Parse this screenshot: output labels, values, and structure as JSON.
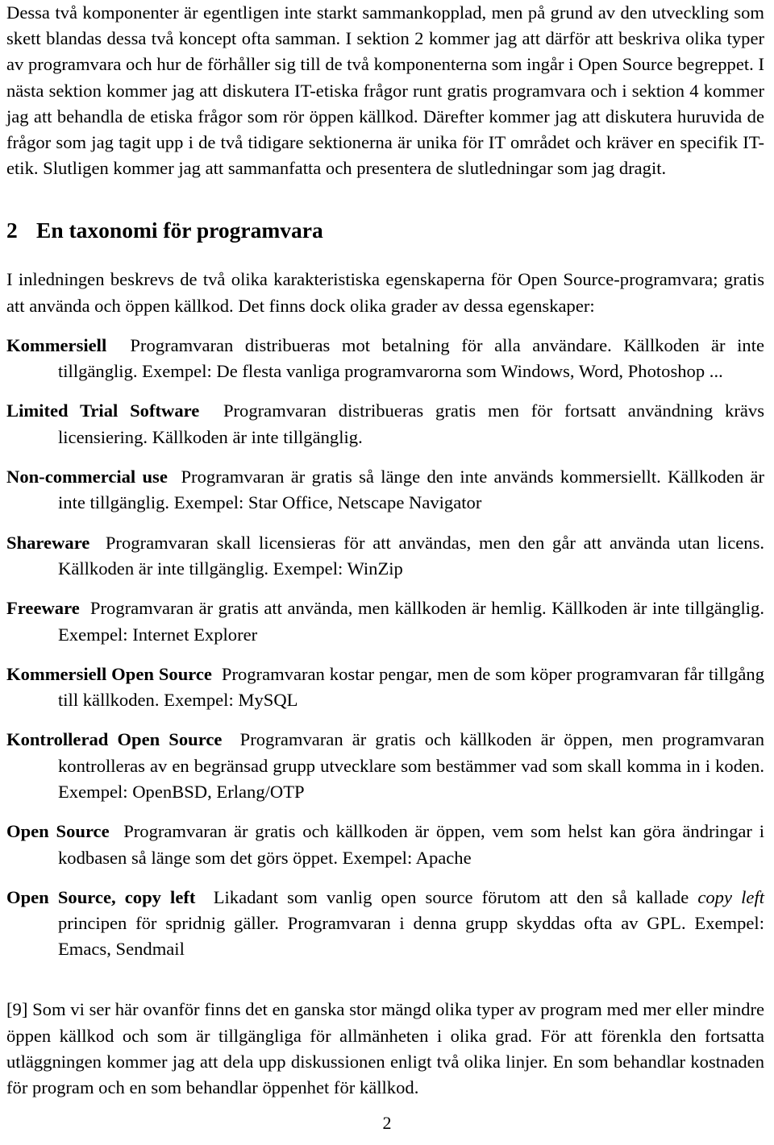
{
  "document": {
    "language": "sv",
    "page_number": "2",
    "paragraphs": {
      "intro": "Dessa två komponenter är egentligen inte starkt sammankopplad, men på grund av den utveckling som skett blandas dessa två koncept ofta samman. I sektion 2 kommer jag att därför att beskriva olika typer av programvara och hur de förhåller sig till de två komponenterna som ingår i Open Source begreppet. I nästa sektion kommer jag att diskutera IT-etiska frågor runt gratis programvara och i sektion 4 kommer jag att behandla de etiska frågor som rör öppen källkod. Därefter kommer jag att diskutera huruvida de frågor som jag tagit upp i de två tidigare sektionerna är unika för IT området och kräver en specifik IT-etik. Slutligen kommer jag att sammanfatta och presentera de slutledningar som jag dragit.",
      "section_intro": "I inledningen beskrevs de två olika karakteristiska egenskaperna för Open Source-programvara; gratis att använda och öppen källkod. Det finns dock olika grader av dessa egenskaper:",
      "final": "[9] Som vi ser här ovanför finns det en ganska stor mängd olika typer av program med mer eller mindre öppen källkod och som är tillgängliga för allmänheten i olika grad. För att förenkla den fortsatta utläggningen kommer jag att dela upp diskussionen enligt två olika linjer. En som behandlar kostnaden för program och en som behandlar öppenhet för källkod."
    },
    "section": {
      "number": "2",
      "title": "En taxonomi för programvara"
    },
    "taxonomy": [
      {
        "term": "Kommersiell",
        "description": "Programvaran distribueras mot betalning för alla användare. Källkoden är inte tillgänglig. Exempel: De flesta vanliga programvarorna som Windows, Word, Photoshop ..."
      },
      {
        "term": "Limited Trial Software",
        "description": "Programvaran distribueras gratis men för fortsatt användning krävs licensiering. Källkoden är inte tillgänglig."
      },
      {
        "term": "Non-commercial use",
        "description": "Programvaran är gratis så länge den inte används kommersiellt. Källkoden är inte tillgänglig. Exempel: Star Office, Netscape Navigator"
      },
      {
        "term": "Shareware",
        "description": "Programvaran skall licensieras för att användas, men den går att använda utan licens. Källkoden är inte tillgänglig. Exempel: WinZip"
      },
      {
        "term": "Freeware",
        "description": "Programvaran är gratis att använda, men källkoden är hemlig. Källkoden är inte tillgänglig. Exempel: Internet Explorer"
      },
      {
        "term": "Kommersiell Open Source",
        "description": "Programvaran kostar pengar, men de som köper programvaran får tillgång till källkoden. Exempel: MySQL"
      },
      {
        "term": "Kontrollerad Open Source",
        "description": "Programvaran är gratis och källkoden är öppen, men programvaran kontrolleras av en begränsad grupp utvecklare som bestämmer vad som skall komma in i koden. Exempel: OpenBSD, Erlang/OTP"
      },
      {
        "term": "Open Source",
        "description": "Programvaran är gratis och källkoden är öppen, vem som helst kan göra ändringar i kodbasen så länge som det görs öppet. Exempel: Apache"
      },
      {
        "term": "Open Source, copy left",
        "description_before_italic": "Likadant som vanlig open source förutom att den så kallade ",
        "italic_phrase": "copy left",
        "description_after_italic": " principen för spridnig gäller. Programvaran i denna grupp skyddas ofta av GPL. Exempel: Emacs, Sendmail"
      }
    ]
  }
}
